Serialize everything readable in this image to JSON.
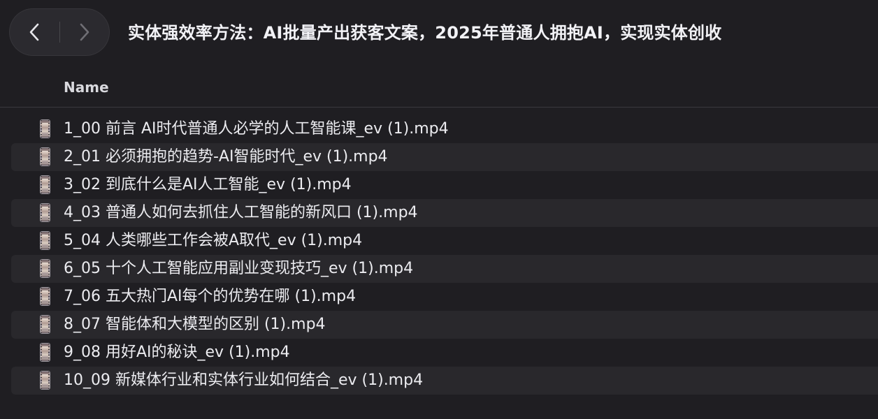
{
  "window": {
    "title": "实体强效率方法：AI批量产出获客文案，2025年普通人拥抱AI，实现实体创收"
  },
  "toolbar": {
    "back_icon": "chevron-left-icon",
    "forward_icon": "chevron-right-icon"
  },
  "columns": {
    "name": "Name"
  },
  "files": [
    {
      "name": "1_00 前言 AI时代普通人必学的人工智能课_ev (1).mp4",
      "icon": "video-file-icon"
    },
    {
      "name": "2_01 必须拥抱的趋势-AI智能时代_ev (1).mp4",
      "icon": "video-file-icon"
    },
    {
      "name": "3_02 到底什么是AI人工智能_ev (1).mp4",
      "icon": "video-file-icon"
    },
    {
      "name": "4_03 普通人如何去抓住人工智能的新风口 (1).mp4",
      "icon": "video-file-icon"
    },
    {
      "name": "5_04 人类哪些工作会被A取代_ev (1).mp4",
      "icon": "video-file-icon"
    },
    {
      "name": "6_05 十个人工智能应用副业变现技巧_ev (1).mp4",
      "icon": "video-file-icon"
    },
    {
      "name": "7_06 五大热门AI每个的优势在哪 (1).mp4",
      "icon": "video-file-icon"
    },
    {
      "name": "8_07 智能体和大模型的区别 (1).mp4",
      "icon": "video-file-icon"
    },
    {
      "name": "9_08 用好AI的秘诀_ev (1).mp4",
      "icon": "video-file-icon"
    },
    {
      "name": "10_09 新媒体行业和实体行业如何结合_ev (1).mp4",
      "icon": "video-file-icon"
    }
  ],
  "colors": {
    "background": "#1f1e22",
    "row_alt": "#29282c",
    "text": "#ececf0"
  }
}
